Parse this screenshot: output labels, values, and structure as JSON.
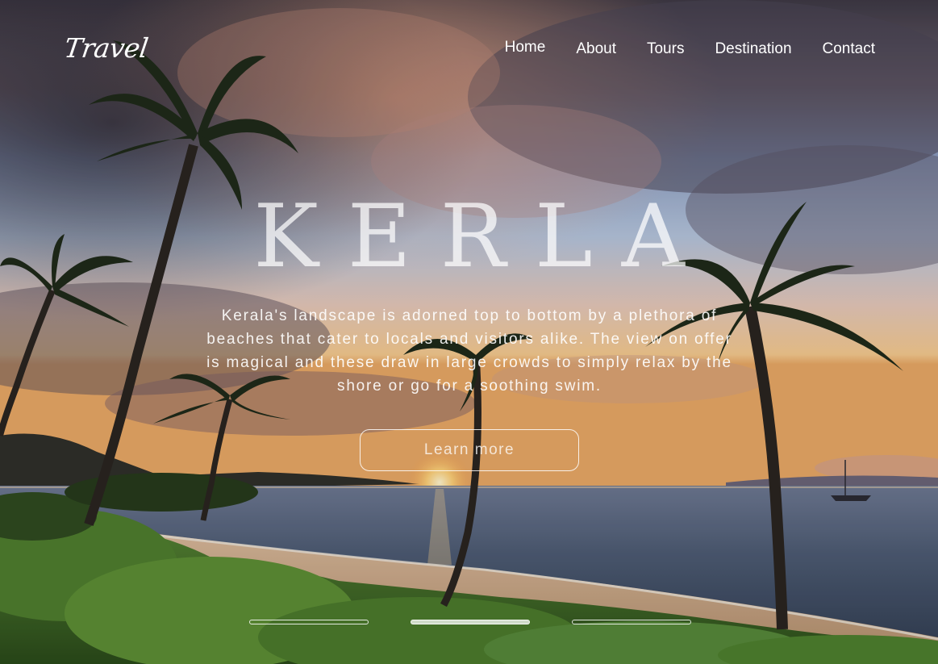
{
  "brand": {
    "logo": "Travel"
  },
  "nav": {
    "items": [
      "Home",
      "About",
      "Tours",
      "Destination",
      "Contact"
    ]
  },
  "hero": {
    "title": "KERLA",
    "description": "Kerala's landscape is adorned top to bottom by a plethora of beaches that cater to locals and visitors alike. The view on offer is magical and these draw in large crowds to simply relax by the shore or go for a soothing swim.",
    "cta_label": "Learn more"
  },
  "slider": {
    "count": 3,
    "active_index": 1
  },
  "colors": {
    "text": "#ffffff",
    "sky_top": "#5b5560",
    "sky_mid": "#9fb3d4",
    "sunset": "#f6c07a",
    "sea": "#3c4a5e",
    "foliage": "#3d6a28"
  },
  "background": {
    "scene": "beach-sunset-palms"
  }
}
